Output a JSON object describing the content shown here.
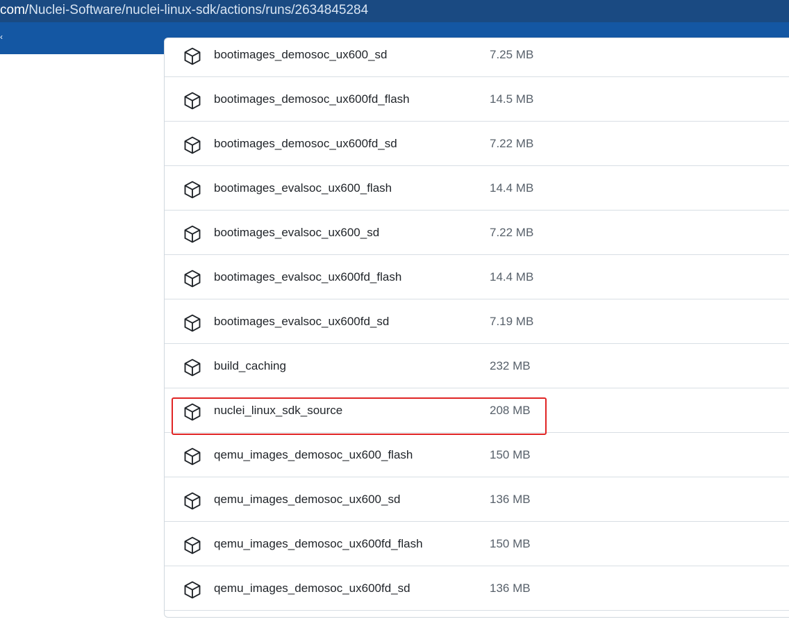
{
  "address_bar": {
    "host": "com/",
    "path": "Nuclei-Software/nuclei-linux-sdk/actions/runs/2634845284"
  },
  "toolbar": {
    "glyph": "‹"
  },
  "artifacts": [
    {
      "name": "bootimages_demosoc_ux600_sd",
      "size": "7.25 MB",
      "icon": "package-icon"
    },
    {
      "name": "bootimages_demosoc_ux600fd_flash",
      "size": "14.5 MB",
      "icon": "package-icon"
    },
    {
      "name": "bootimages_demosoc_ux600fd_sd",
      "size": "7.22 MB",
      "icon": "package-icon"
    },
    {
      "name": "bootimages_evalsoc_ux600_flash",
      "size": "14.4 MB",
      "icon": "package-icon"
    },
    {
      "name": "bootimages_evalsoc_ux600_sd",
      "size": "7.22 MB",
      "icon": "package-icon"
    },
    {
      "name": "bootimages_evalsoc_ux600fd_flash",
      "size": "14.4 MB",
      "icon": "package-icon"
    },
    {
      "name": "bootimages_evalsoc_ux600fd_sd",
      "size": "7.19 MB",
      "icon": "package-icon"
    },
    {
      "name": "build_caching",
      "size": "232 MB",
      "icon": "package-icon"
    },
    {
      "name": "nuclei_linux_sdk_source",
      "size": "208 MB",
      "icon": "package-icon",
      "highlighted": true
    },
    {
      "name": "qemu_images_demosoc_ux600_flash",
      "size": "150 MB",
      "icon": "package-icon"
    },
    {
      "name": "qemu_images_demosoc_ux600_sd",
      "size": "136 MB",
      "icon": "package-icon"
    },
    {
      "name": "qemu_images_demosoc_ux600fd_flash",
      "size": "150 MB",
      "icon": "package-icon"
    },
    {
      "name": "qemu_images_demosoc_ux600fd_sd",
      "size": "136 MB",
      "icon": "package-icon"
    }
  ],
  "colors": {
    "address_bar_bg": "#1a4a82",
    "toolbar_bg": "#1457a3",
    "highlight_border": "#e02424",
    "row_divider": "#d8dee4"
  }
}
